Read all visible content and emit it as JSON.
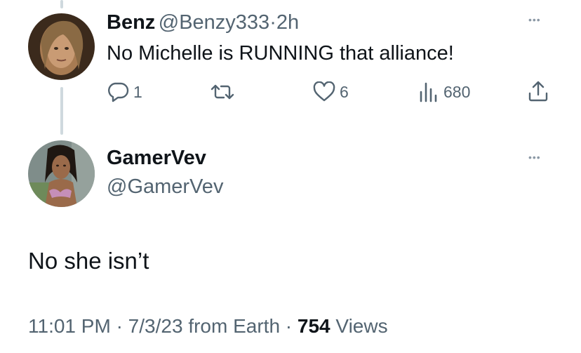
{
  "reply_tweet": {
    "display_name": "Benz",
    "handle": "@Benzy333",
    "separator": "·",
    "time_ago": "2h",
    "text": "No Michelle is RUNNING that alliance!",
    "more_glyph": "•••",
    "actions": {
      "replies": "1",
      "likes": "6",
      "views": "680"
    }
  },
  "main_tweet": {
    "display_name": "GamerVev",
    "handle": "@GamerVev",
    "more_glyph": "•••",
    "text": "No she isn’t",
    "meta": {
      "time": "11:01 PM",
      "date": "7/3/23",
      "source": "from Earth",
      "views_count": "754",
      "views_label": "Views",
      "separator": "·"
    }
  },
  "icons": [
    "reply-icon",
    "retweet-icon",
    "like-icon",
    "views-icon",
    "share-icon",
    "more-icon"
  ],
  "colors": {
    "text": "#0f1419",
    "muted": "#536471",
    "thread_line": "#cfd9de",
    "background": "#ffffff"
  }
}
